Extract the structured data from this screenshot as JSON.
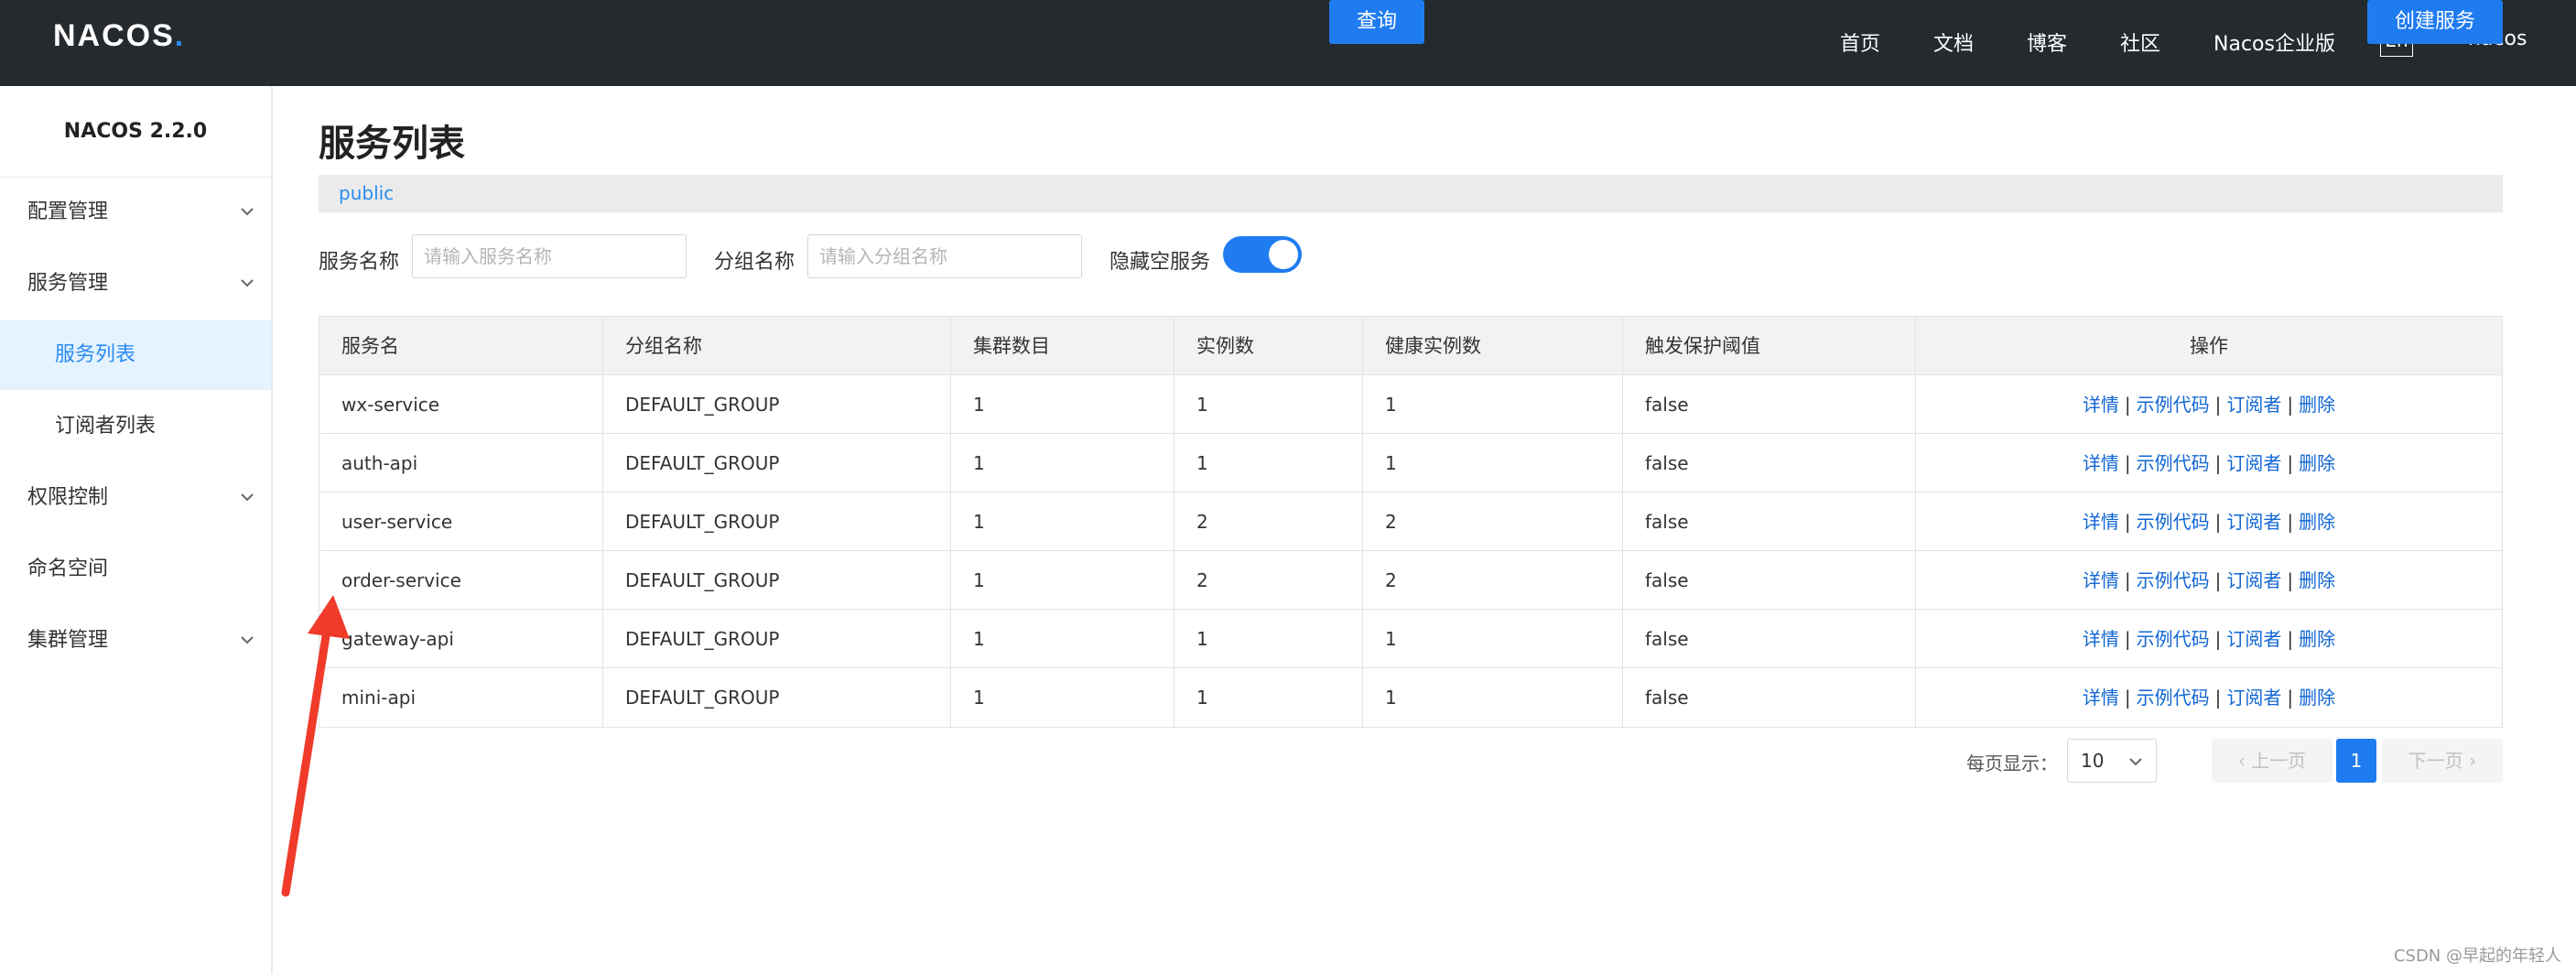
{
  "header": {
    "logo": "NACOS",
    "logo_dot": ".",
    "nav": [
      "首页",
      "文档",
      "博客",
      "社区",
      "Nacos企业版"
    ],
    "lang": "En",
    "user": "nacos"
  },
  "sidebar": {
    "title": "NACOS 2.2.0",
    "items": [
      {
        "label": "配置管理",
        "expandable": true
      },
      {
        "label": "服务管理",
        "expandable": true
      },
      {
        "label": "服务列表",
        "sub": true,
        "active": true
      },
      {
        "label": "订阅者列表",
        "sub": true
      },
      {
        "label": "权限控制",
        "expandable": true
      },
      {
        "label": "命名空间"
      },
      {
        "label": "集群管理",
        "expandable": true
      }
    ]
  },
  "main": {
    "title": "服务列表",
    "namespace": "public",
    "filters": {
      "service_name_label": "服务名称",
      "service_name_placeholder": "请输入服务名称",
      "group_name_label": "分组名称",
      "group_name_placeholder": "请输入分组名称",
      "hide_empty_label": "隐藏空服务",
      "hide_empty_on": true,
      "query_button": "查询",
      "create_button": "创建服务"
    },
    "table": {
      "headers": [
        "服务名",
        "分组名称",
        "集群数目",
        "实例数",
        "健康实例数",
        "触发保护阈值",
        "操作"
      ],
      "rows": [
        [
          "wx-service",
          "DEFAULT_GROUP",
          "1",
          "1",
          "1",
          "false"
        ],
        [
          "auth-api",
          "DEFAULT_GROUP",
          "1",
          "1",
          "1",
          "false"
        ],
        [
          "user-service",
          "DEFAULT_GROUP",
          "1",
          "2",
          "2",
          "false"
        ],
        [
          "order-service",
          "DEFAULT_GROUP",
          "1",
          "2",
          "2",
          "false"
        ],
        [
          "gateway-api",
          "DEFAULT_GROUP",
          "1",
          "1",
          "1",
          "false"
        ],
        [
          "mini-api",
          "DEFAULT_GROUP",
          "1",
          "1",
          "1",
          "false"
        ]
      ],
      "ops": [
        "详情",
        "示例代码",
        "订阅者",
        "删除"
      ],
      "ops_separator": "|"
    },
    "pagination": {
      "page_size_label": "每页显示：",
      "page_size": "10",
      "prev": "上一页",
      "current_page": "1",
      "next": "下一页"
    }
  },
  "watermark": "CSDN @早起的年轻人",
  "colors": {
    "header_bg": "#252a2f",
    "accent": "#1f7cf0",
    "annotation_arrow": "#f03a2a"
  }
}
